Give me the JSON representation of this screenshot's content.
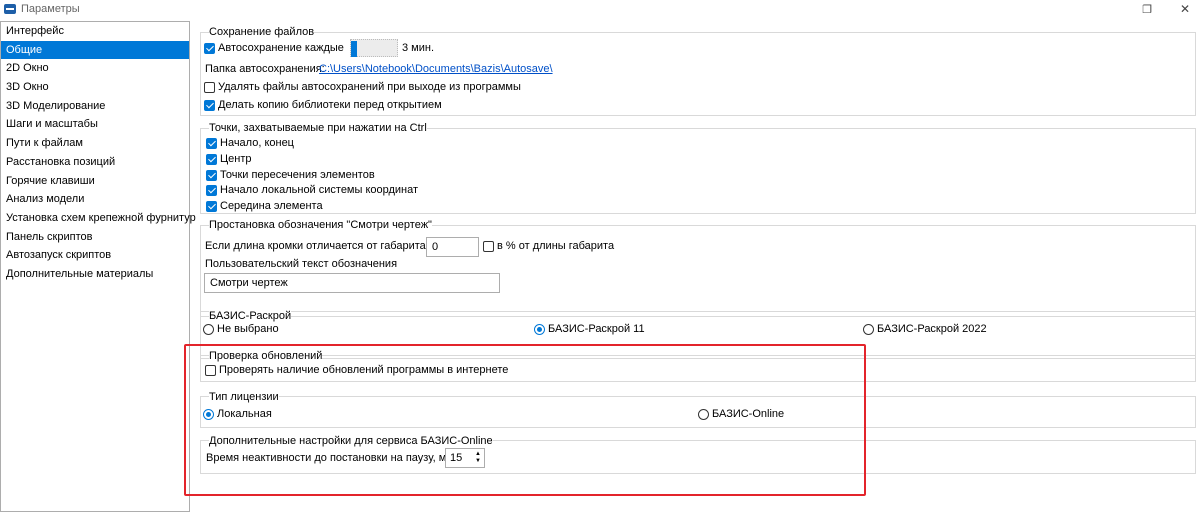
{
  "window": {
    "title": "Параметры",
    "restore_icon": "restore-icon",
    "close_icon": "close-icon"
  },
  "sidebar": {
    "items": [
      {
        "label": "Интерфейс",
        "selected": false
      },
      {
        "label": "Общие",
        "selected": true
      },
      {
        "label": "2D Окно",
        "selected": false
      },
      {
        "label": "3D Окно",
        "selected": false
      },
      {
        "label": "3D Моделирование",
        "selected": false
      },
      {
        "label": "Шаги и масштабы",
        "selected": false
      },
      {
        "label": "Пути к файлам",
        "selected": false
      },
      {
        "label": "Расстановка позиций",
        "selected": false
      },
      {
        "label": "Горячие клавиши",
        "selected": false
      },
      {
        "label": "Анализ модели",
        "selected": false
      },
      {
        "label": "Установка схем крепежной фурнитуры",
        "selected": false
      },
      {
        "label": "Панель скриптов",
        "selected": false
      },
      {
        "label": "Автозапуск скриптов",
        "selected": false
      },
      {
        "label": "Дополнительные материалы",
        "selected": false
      }
    ]
  },
  "file_saving": {
    "title": "Сохранение файлов",
    "autosave_label": "Автосохранение каждые",
    "autosave_checked": true,
    "autosave_minutes": "3 мин.",
    "folder_label": "Папка автосохранения:",
    "folder_path": "C:\\Users\\Notebook\\Documents\\Bazis\\Autosave\\",
    "delete_on_exit_label": "Удалять файлы автосохранений при выходе из программы",
    "delete_on_exit_checked": false,
    "backup_library_label": "Делать копию библиотеки перед открытием",
    "backup_library_checked": true
  },
  "snap_points": {
    "title": "Точки, захватываемые при нажатии на Ctrl",
    "items": [
      {
        "label": "Начало, конец",
        "checked": true
      },
      {
        "label": "Центр",
        "checked": true
      },
      {
        "label": "Точки пересечения элементов",
        "checked": true
      },
      {
        "label": "Начало локальной системы координат",
        "checked": true
      },
      {
        "label": "Середина элемента",
        "checked": true
      }
    ]
  },
  "see_drawing": {
    "title": "Простановка обозначения \"Смотри чертеж\"",
    "edge_label": "Если длина кромки отличается от габарита на",
    "edge_value": "0",
    "percent_label": "в % от длины габарита",
    "percent_checked": false,
    "custom_text_label": "Пользовательский текст обозначения",
    "custom_text_value": "Смотри чертеж"
  },
  "bazis_cutting": {
    "title": "БАЗИС-Раскрой",
    "options": [
      {
        "label": "Не выбрано",
        "checked": false
      },
      {
        "label": "БАЗИС-Раскрой 11",
        "checked": true
      },
      {
        "label": "БАЗИС-Раскрой 2022",
        "checked": false
      }
    ]
  },
  "updates": {
    "title": "Проверка обновлений",
    "check_label": "Проверять наличие обновлений программы в интернете",
    "check_checked": false
  },
  "license": {
    "title": "Тип лицензии",
    "options": [
      {
        "label": "Локальная",
        "checked": true
      },
      {
        "label": "БАЗИС-Online",
        "checked": false
      }
    ]
  },
  "online_settings": {
    "title": "Дополнительные настройки для сервиса БАЗИС-Online",
    "idle_label": "Время неактивности до постановки на паузу, мин.",
    "idle_value": "15"
  },
  "colors": {
    "accent": "#0078d7",
    "highlight": "#e3242b",
    "link": "#0050c8"
  }
}
